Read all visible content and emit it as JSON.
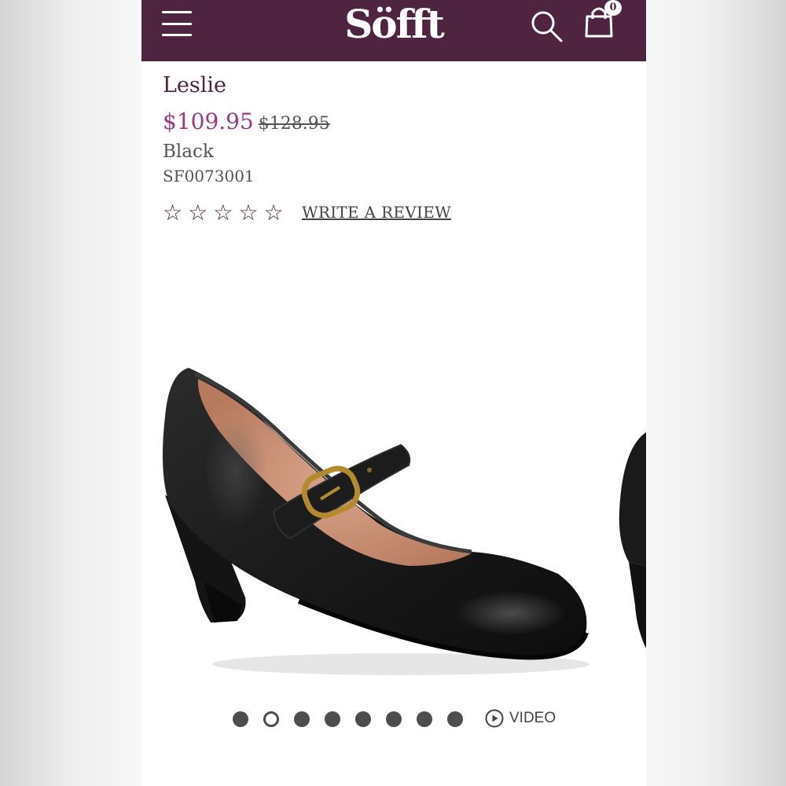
{
  "header": {
    "logo": "Söfft",
    "icons": [
      "menu-icon",
      "search-icon",
      "shopping-bag-icon"
    ],
    "cart_count": "0",
    "background": "#4f2440"
  },
  "product": {
    "name": "Leslie",
    "sale_price": "$109.95",
    "original_price": "$128.95",
    "color": "Black",
    "sku": "SF0073001",
    "rating_stars": 0,
    "rating_max": 5,
    "write_review": "WRITE A REVIEW"
  },
  "gallery": {
    "image_count": 8,
    "active_index": 1,
    "video_label": "VIDEO"
  },
  "colors": {
    "brand": "#4f2440",
    "price": "#9c3a86"
  }
}
